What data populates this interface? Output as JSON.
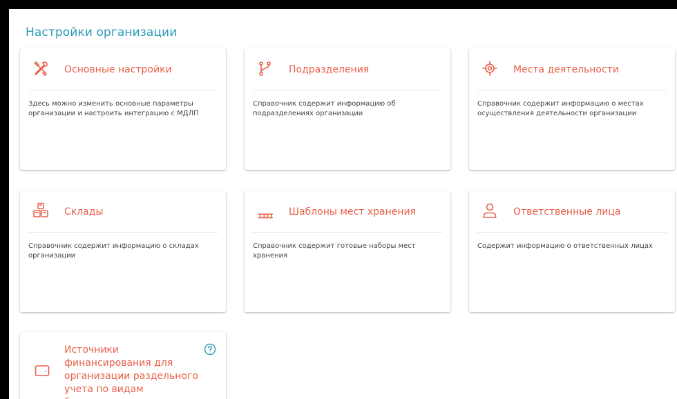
{
  "page": {
    "title": "Настройки организации"
  },
  "cards": [
    {
      "title": "Основные настройки",
      "icon": "tools-icon",
      "description": "Здесь можно изменить основные параметры организации и настроить интеграцию с МДЛП"
    },
    {
      "title": "Подразделения",
      "icon": "branch-icon",
      "description": "Справочник содержит информацию об подразделениях организации"
    },
    {
      "title": "Места деятельности",
      "icon": "target-location-icon",
      "description": "Справочник содержит информацию о местах осуществления деятельности организации"
    },
    {
      "title": "Склады",
      "icon": "warehouse-boxes-icon",
      "description": "Справочник содержит информацию о складах организации"
    },
    {
      "title": "Шаблоны мест хранения",
      "icon": "shelf-icon",
      "description": "Справочник содержит готовые наборы мест хранения"
    },
    {
      "title": "Ответственные лица",
      "icon": "person-icon",
      "description": "Содержит информацию о ответственных лицах"
    },
    {
      "title": "Источники финансирования для организации раздельного учета по видам бюджетирования",
      "icon": "wallet-icon",
      "help_icon": "help-circle-icon"
    }
  ],
  "colors": {
    "accent": "#e8604a",
    "title": "#2a9bb8",
    "help": "#2a9bb8"
  }
}
